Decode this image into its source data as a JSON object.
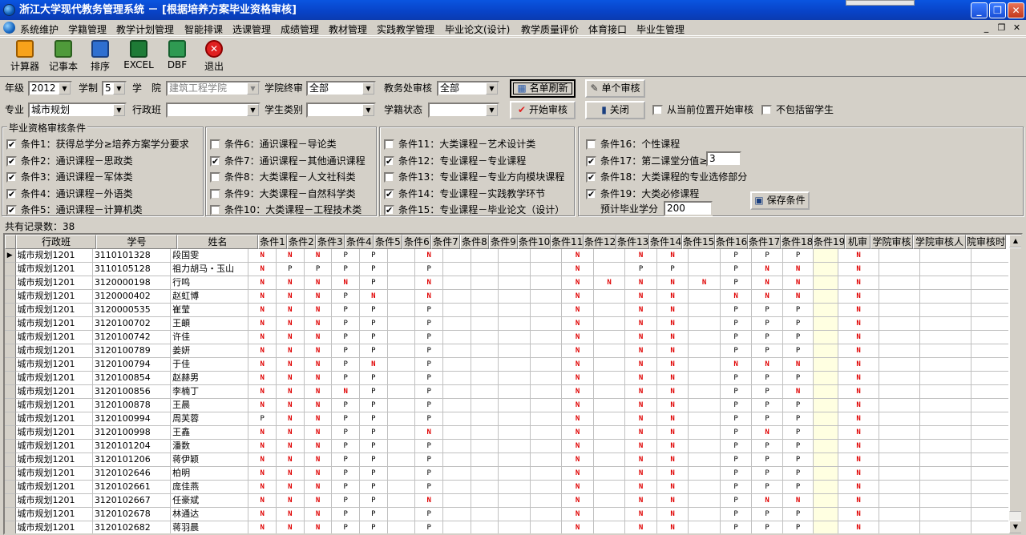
{
  "window": {
    "title": "浙江大学现代教务管理系统 － [根据培养方案毕业资格审核]",
    "caption_buttons": [
      "_",
      "❐",
      "✕"
    ]
  },
  "menu": {
    "items": [
      "系统维护",
      "学籍管理",
      "教学计划管理",
      "智能排课",
      "选课管理",
      "成绩管理",
      "教材管理",
      "实践教学管理",
      "毕业论文(设计)",
      "教学质量评价",
      "体育接口",
      "毕业生管理"
    ],
    "mdi_buttons": [
      "_",
      "❐",
      "✕"
    ]
  },
  "toolbar": {
    "items": [
      {
        "label": "计算器",
        "icon": "calculator-icon",
        "color": "#f7a21b"
      },
      {
        "label": "记事本",
        "icon": "notepad-icon",
        "color": "#4f9a3a"
      },
      {
        "label": "排序",
        "icon": "sort-icon",
        "color": "#2f6fd0"
      },
      {
        "label": "EXCEL",
        "icon": "excel-icon",
        "color": "#1e7b36"
      },
      {
        "label": "DBF",
        "icon": "dbf-icon",
        "color": "#2f9a52"
      },
      {
        "label": "退出",
        "icon": "exit-icon",
        "color": "#e02020"
      }
    ]
  },
  "filter": {
    "grade_label": "年级",
    "grade_value": "2012",
    "schooling_label": "学制",
    "schooling_value": "5",
    "college_label": "学　院",
    "college_value": "建筑工程学院",
    "college_final_label": "学院终审",
    "college_final_value": "全部",
    "office_label": "教务处审核",
    "office_value": "全部",
    "refresh_button": "名单刷新",
    "single_button": "单个审核",
    "major_label": "专业",
    "major_value": "城市规划",
    "class_label": "行政班",
    "class_value": "",
    "student_type_label": "学生类别",
    "student_type_value": "",
    "status_label": "学籍状态",
    "status_value": "",
    "start_button": "开始审核",
    "close_button": "关闭",
    "from_current_label": "从当前位置开始审核",
    "exclude_label": "不包括留学生"
  },
  "conditions": {
    "legend": "毕业资格审核条件",
    "groups": [
      [
        {
          "label": "条件1：获得总学分≥培养方案学分要求",
          "checked": true
        },
        {
          "label": "条件2：通识课程－思政类",
          "checked": true
        },
        {
          "label": "条件3：通识课程－军体类",
          "checked": true
        },
        {
          "label": "条件4：通识课程－外语类",
          "checked": true
        },
        {
          "label": "条件5：通识课程－计算机类",
          "checked": true
        }
      ],
      [
        {
          "label": "条件6：通识课程－导论类",
          "checked": false
        },
        {
          "label": "条件7：通识课程－其他通识课程",
          "checked": true
        },
        {
          "label": "条件8：大类课程－人文社科类",
          "checked": false
        },
        {
          "label": "条件9：大类课程－自然科学类",
          "checked": false
        },
        {
          "label": "条件10：大类课程－工程技术类",
          "checked": false
        }
      ],
      [
        {
          "label": "条件11：大类课程－艺术设计类",
          "checked": false
        },
        {
          "label": "条件12：专业课程－专业课程",
          "checked": true
        },
        {
          "label": "条件13：专业课程－专业方向模块课程",
          "checked": false
        },
        {
          "label": "条件14：专业课程－实践教学环节",
          "checked": true
        },
        {
          "label": "条件15：专业课程－毕业论文（设计）",
          "checked": true
        }
      ],
      [
        {
          "label": "条件16：个性课程",
          "checked": false
        },
        {
          "label": "条件17：第二课堂分值≥",
          "checked": true
        },
        {
          "label": "条件18：大类课程的专业选修部分",
          "checked": true
        },
        {
          "label": "条件19：大类必修课程",
          "checked": true
        }
      ]
    ],
    "cond17_value": "3",
    "credit_label": "预计毕业学分",
    "credit_value": "200",
    "save_button": "保存条件"
  },
  "record_count": "共有记录数：38",
  "grid": {
    "headers": [
      "行政班",
      "学号",
      "姓名",
      "条件1",
      "条件2",
      "条件3",
      "条件4",
      "条件5",
      "条件6",
      "条件7",
      "条件8",
      "条件9",
      "条件10",
      "条件11",
      "条件12",
      "条件13",
      "条件14",
      "条件15",
      "条件16",
      "条件17",
      "条件18",
      "条件19",
      "机审",
      "学院审核",
      "学院审核人",
      "院审核时"
    ],
    "rows": [
      {
        "cls": "城市规划1201",
        "id": "3110101328",
        "name": "段国雯",
        "c": [
          "N",
          "N",
          "N",
          "P",
          "P",
          "",
          "N",
          "",
          "",
          "",
          "",
          "N",
          "",
          "N",
          "N",
          "",
          "P",
          "P",
          "P",
          "",
          "N"
        ]
      },
      {
        "cls": "城市规划1201",
        "id": "3110105128",
        "name": "祖力胡马・玉山",
        "c": [
          "N",
          "P",
          "P",
          "P",
          "P",
          "",
          "P",
          "",
          "",
          "",
          "",
          "N",
          "",
          "P",
          "P",
          "",
          "P",
          "N",
          "N",
          "",
          "N"
        ]
      },
      {
        "cls": "城市规划1201",
        "id": "3120000198",
        "name": "行鸣",
        "c": [
          "N",
          "N",
          "N",
          "N",
          "P",
          "",
          "N",
          "",
          "",
          "",
          "",
          "N",
          "N",
          "N",
          "N",
          "N",
          "P",
          "N",
          "N",
          "",
          "N"
        ]
      },
      {
        "cls": "城市规划1201",
        "id": "3120000402",
        "name": "赵虹博",
        "c": [
          "N",
          "N",
          "N",
          "P",
          "N",
          "",
          "N",
          "",
          "",
          "",
          "",
          "N",
          "",
          "N",
          "N",
          "",
          "N",
          "N",
          "N",
          "",
          "N"
        ]
      },
      {
        "cls": "城市规划1201",
        "id": "3120000535",
        "name": "崔莹",
        "c": [
          "N",
          "N",
          "N",
          "P",
          "P",
          "",
          "P",
          "",
          "",
          "",
          "",
          "N",
          "",
          "N",
          "N",
          "",
          "P",
          "P",
          "P",
          "",
          "N"
        ]
      },
      {
        "cls": "城市规划1201",
        "id": "3120100702",
        "name": "王頔",
        "c": [
          "N",
          "N",
          "N",
          "P",
          "P",
          "",
          "P",
          "",
          "",
          "",
          "",
          "N",
          "",
          "N",
          "N",
          "",
          "P",
          "P",
          "P",
          "",
          "N"
        ]
      },
      {
        "cls": "城市规划1201",
        "id": "3120100742",
        "name": "许佳",
        "c": [
          "N",
          "N",
          "N",
          "P",
          "P",
          "",
          "P",
          "",
          "",
          "",
          "",
          "N",
          "",
          "N",
          "N",
          "",
          "P",
          "P",
          "P",
          "",
          "N"
        ]
      },
      {
        "cls": "城市规划1201",
        "id": "3120100789",
        "name": "姜妍",
        "c": [
          "N",
          "N",
          "N",
          "P",
          "P",
          "",
          "P",
          "",
          "",
          "",
          "",
          "N",
          "",
          "N",
          "N",
          "",
          "P",
          "P",
          "P",
          "",
          "N"
        ]
      },
      {
        "cls": "城市规划1201",
        "id": "3120100794",
        "name": "于佳",
        "c": [
          "N",
          "N",
          "N",
          "P",
          "N",
          "",
          "P",
          "",
          "",
          "",
          "",
          "N",
          "",
          "N",
          "N",
          "",
          "N",
          "N",
          "N",
          "",
          "N"
        ]
      },
      {
        "cls": "城市规划1201",
        "id": "3120100854",
        "name": "赵赫男",
        "c": [
          "N",
          "N",
          "N",
          "P",
          "P",
          "",
          "P",
          "",
          "",
          "",
          "",
          "N",
          "",
          "N",
          "N",
          "",
          "P",
          "P",
          "P",
          "",
          "N"
        ]
      },
      {
        "cls": "城市规划1201",
        "id": "3120100856",
        "name": "李楠丁",
        "c": [
          "N",
          "N",
          "N",
          "N",
          "P",
          "",
          "P",
          "",
          "",
          "",
          "",
          "N",
          "",
          "N",
          "N",
          "",
          "P",
          "P",
          "N",
          "",
          "N"
        ]
      },
      {
        "cls": "城市规划1201",
        "id": "3120100878",
        "name": "王晨",
        "c": [
          "N",
          "N",
          "N",
          "P",
          "P",
          "",
          "P",
          "",
          "",
          "",
          "",
          "N",
          "",
          "N",
          "N",
          "",
          "P",
          "P",
          "P",
          "",
          "N"
        ]
      },
      {
        "cls": "城市规划1201",
        "id": "3120100994",
        "name": "周芙蓉",
        "c": [
          "P",
          "N",
          "N",
          "P",
          "P",
          "",
          "P",
          "",
          "",
          "",
          "",
          "N",
          "",
          "N",
          "N",
          "",
          "P",
          "P",
          "P",
          "",
          "N"
        ]
      },
      {
        "cls": "城市规划1201",
        "id": "3120100998",
        "name": "王鑫",
        "c": [
          "N",
          "N",
          "N",
          "P",
          "P",
          "",
          "N",
          "",
          "",
          "",
          "",
          "N",
          "",
          "N",
          "N",
          "",
          "P",
          "N",
          "P",
          "",
          "N"
        ]
      },
      {
        "cls": "城市规划1201",
        "id": "3120101204",
        "name": "潘数",
        "c": [
          "N",
          "N",
          "N",
          "P",
          "P",
          "",
          "P",
          "",
          "",
          "",
          "",
          "N",
          "",
          "N",
          "N",
          "",
          "P",
          "P",
          "P",
          "",
          "N"
        ]
      },
      {
        "cls": "城市规划1201",
        "id": "3120101206",
        "name": "蒋伊颖",
        "c": [
          "N",
          "N",
          "N",
          "P",
          "P",
          "",
          "P",
          "",
          "",
          "",
          "",
          "N",
          "",
          "N",
          "N",
          "",
          "P",
          "P",
          "P",
          "",
          "N"
        ]
      },
      {
        "cls": "城市规划1201",
        "id": "3120102646",
        "name": "柏明",
        "c": [
          "N",
          "N",
          "N",
          "P",
          "P",
          "",
          "P",
          "",
          "",
          "",
          "",
          "N",
          "",
          "N",
          "N",
          "",
          "P",
          "P",
          "P",
          "",
          "N"
        ]
      },
      {
        "cls": "城市规划1201",
        "id": "3120102661",
        "name": "庞佳燕",
        "c": [
          "N",
          "N",
          "N",
          "P",
          "P",
          "",
          "P",
          "",
          "",
          "",
          "",
          "N",
          "",
          "N",
          "N",
          "",
          "P",
          "P",
          "P",
          "",
          "N"
        ]
      },
      {
        "cls": "城市规划1201",
        "id": "3120102667",
        "name": "任豪斌",
        "c": [
          "N",
          "N",
          "N",
          "P",
          "P",
          "",
          "N",
          "",
          "",
          "",
          "",
          "N",
          "",
          "N",
          "N",
          "",
          "P",
          "N",
          "N",
          "",
          "N"
        ]
      },
      {
        "cls": "城市规划1201",
        "id": "3120102678",
        "name": "林通达",
        "c": [
          "N",
          "N",
          "N",
          "P",
          "P",
          "",
          "P",
          "",
          "",
          "",
          "",
          "N",
          "",
          "N",
          "N",
          "",
          "P",
          "P",
          "P",
          "",
          "N"
        ]
      },
      {
        "cls": "城市规划1201",
        "id": "3120102682",
        "name": "蒋羽晨",
        "c": [
          "N",
          "N",
          "N",
          "P",
          "P",
          "",
          "P",
          "",
          "",
          "",
          "",
          "N",
          "",
          "N",
          "N",
          "",
          "P",
          "P",
          "P",
          "",
          "N"
        ]
      }
    ]
  }
}
